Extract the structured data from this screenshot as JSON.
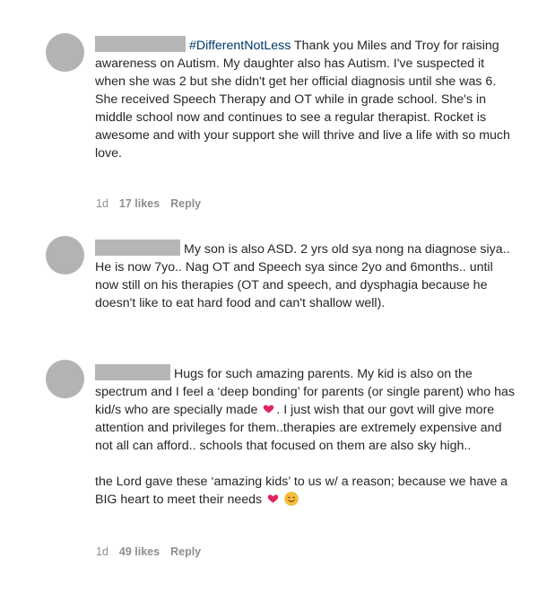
{
  "comments": [
    {
      "hashtag": "#DifferentNotLess",
      "text": " Thank you Miles and Troy for raising awareness on Autism. My daughter also has Autism. I've suspected it when she was 2 but she didn't get her official diagnosis until she was 6. She received Speech Therapy and OT while in grade school. She's in middle school now and continues to see a regular therapist. Rocket is awesome and with your support she will thrive and live a life with so much love.",
      "time": "1d",
      "likes": "17 likes",
      "reply": "Reply"
    },
    {
      "text": "My son is also ASD. 2 yrs old sya nong na diagnose siya.. He is now 7yo.. Nag OT and Speech sya since 2yo and 6months.. until now still on his therapies (OT and speech, and dysphagia because he doesn't like to eat hard food and can't shallow well)."
    },
    {
      "text_part1": "Hugs for such amazing parents. My kid is also on the spectrum and I feel a ‘deep bonding’ for parents (or single parent) who has kid/s who are specially made",
      "text_part2": ". I just wish that our govt will give more attention and privileges for them..therapies are extremely expensive and not all can afford.. schools that focused on them are also sky high..",
      "text_part3": "the Lord gave these ‘amazing kids’ to us w/ a reason; because we have a BIG heart to meet their needs",
      "time": "1d",
      "likes": "49 likes",
      "reply": "Reply"
    }
  ],
  "icons": {
    "heart": "red-heart-emoji",
    "smile": "smiling-face-emoji"
  },
  "colors": {
    "text": "#262626",
    "meta": "#8e8e8e",
    "hashtag": "#00376b",
    "avatar": "#b3b3b3",
    "heart": "#e0245e"
  }
}
